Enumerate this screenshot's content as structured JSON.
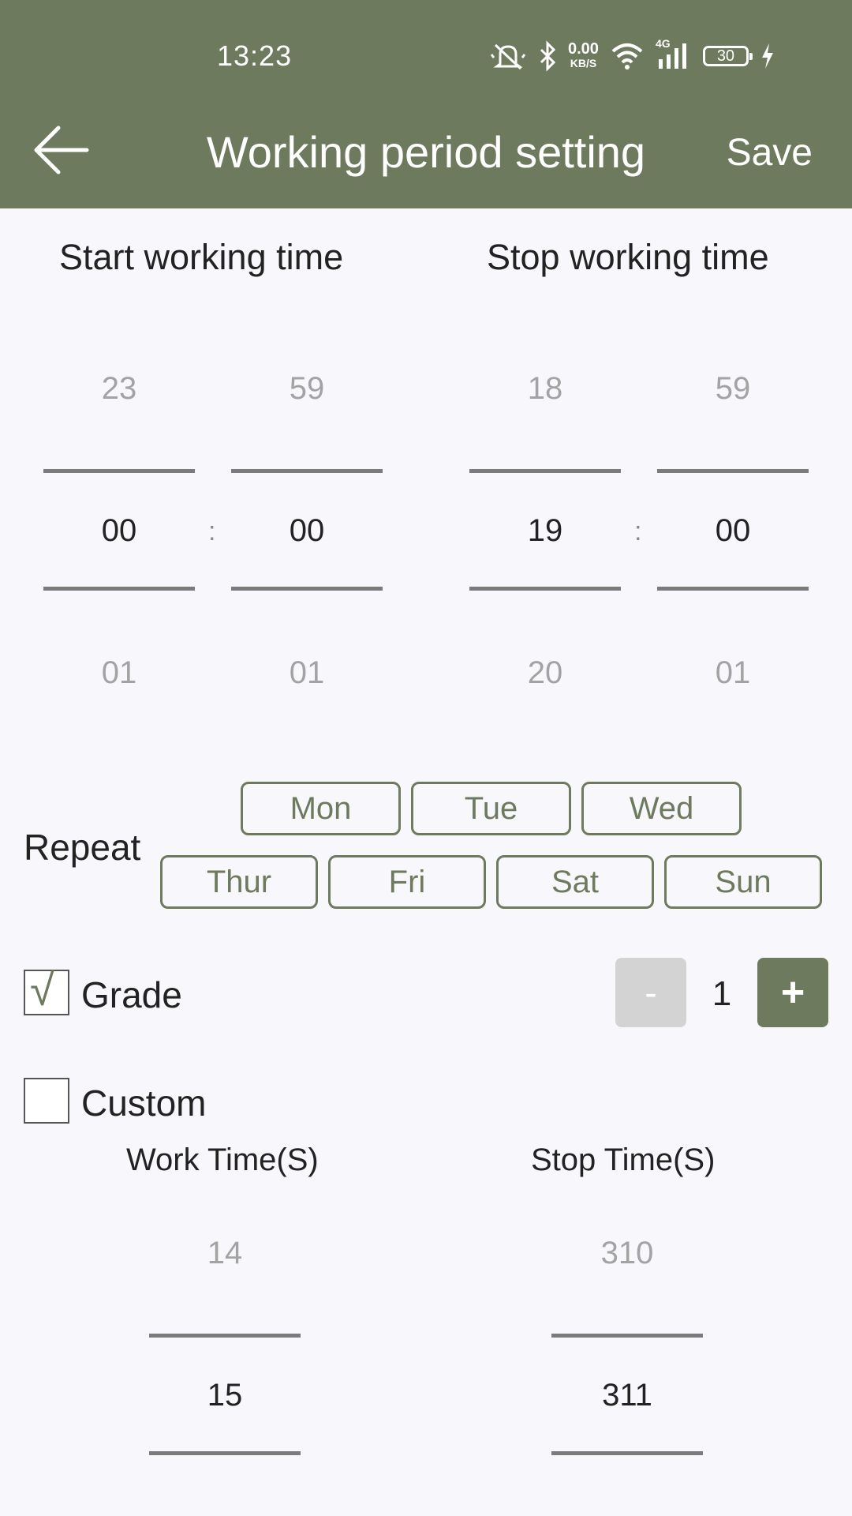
{
  "status_bar": {
    "time": "13:23",
    "net_speed": "0.00",
    "net_unit": "KB/S",
    "network": "4G",
    "battery": "30"
  },
  "header": {
    "title": "Working period setting",
    "save_label": "Save"
  },
  "start": {
    "label": "Start working time",
    "hour": {
      "prev": "23",
      "current": "00",
      "next": "01"
    },
    "minute": {
      "prev": "59",
      "current": "00",
      "next": "01"
    }
  },
  "stop": {
    "label": "Stop working time",
    "hour": {
      "prev": "18",
      "current": "19",
      "next": "20"
    },
    "minute": {
      "prev": "59",
      "current": "00",
      "next": "01"
    }
  },
  "separator": ":",
  "repeat": {
    "label": "Repeat",
    "days": [
      "Mon",
      "Tue",
      "Wed",
      "Thur",
      "Fri",
      "Sat",
      "Sun"
    ]
  },
  "grade": {
    "label": "Grade",
    "checked": true,
    "check_glyph": "√",
    "value": "1",
    "minus": "-",
    "plus": "+"
  },
  "custom": {
    "label": "Custom",
    "checked": false,
    "work": {
      "label": "Work Time(S)",
      "prev": "14",
      "current": "15"
    },
    "stop": {
      "label": "Stop Time(S)",
      "prev": "310",
      "current": "311"
    }
  },
  "colors": {
    "accent": "#6d7a5d",
    "background": "#f8f7fb",
    "disabled": "#d3d3d3"
  }
}
